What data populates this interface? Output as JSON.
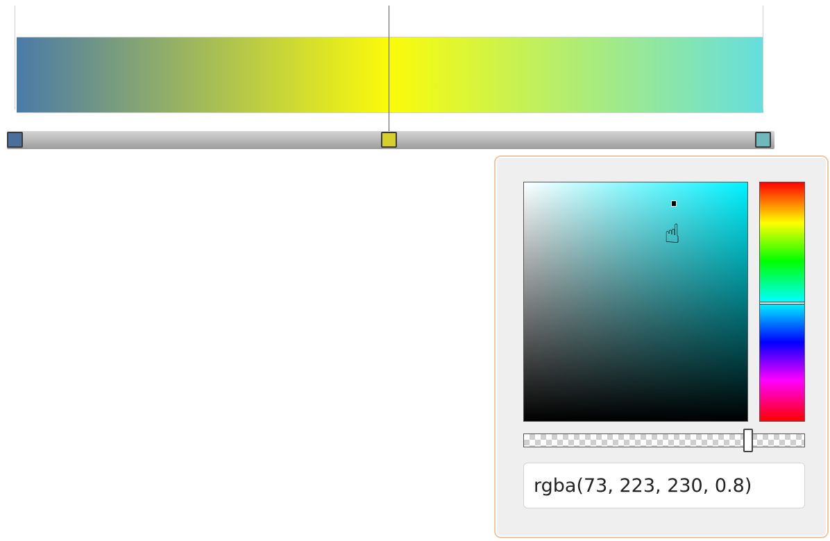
{
  "gradient": {
    "stops": [
      {
        "name": "stop-left",
        "color": "#4a7aa8",
        "position": 0.0
      },
      {
        "name": "stop-middle",
        "color": "#fbfb0a",
        "position": 0.5
      },
      {
        "name": "stop-right",
        "color": "#65dede",
        "position": 1.0
      }
    ],
    "handles": [
      {
        "name": "stop-handle-left",
        "color": "#4b6f9a",
        "selected": false
      },
      {
        "name": "stop-handle-middle",
        "color": "#d6cf2c",
        "selected": true
      },
      {
        "name": "stop-handle-right",
        "color": "#6fb8bb",
        "selected": false
      }
    ]
  },
  "picker": {
    "hue_color": "#00f2ff",
    "hue_fraction": 0.505,
    "saturation": 0.67,
    "value": 0.91,
    "alpha": 0.8,
    "color_value": "rgba(73, 223, 230, 0.8)",
    "cursor_icon": "hand-pointer-icon"
  }
}
